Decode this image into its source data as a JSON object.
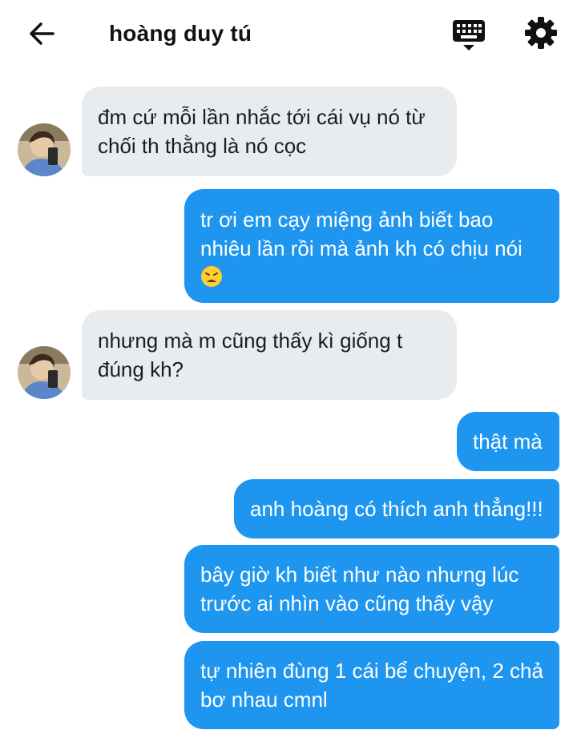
{
  "header": {
    "back_icon": "arrow-left-icon",
    "contact_name": "hoàng duy tú",
    "keyboard_icon": "keyboard-icon",
    "settings_icon": "gear-icon"
  },
  "messages": [
    {
      "direction": "incoming",
      "lines": [
        "đm cứ mỗi lần nhắc tới cái vụ nó từ",
        "chối th thằng là nó cọc"
      ]
    },
    {
      "direction": "outgoing",
      "lines": [
        "tr ơi em cạy miệng ảnh biết bao",
        "nhiêu lần rồi mà ảnh kh có chịu nói"
      ],
      "emoji": "weary-face-emoji"
    },
    {
      "direction": "incoming",
      "lines": [
        "nhưng mà m cũng thấy kì giống t",
        "đúng kh?"
      ]
    },
    {
      "direction": "outgoing",
      "lines": [
        "thật mà"
      ]
    },
    {
      "direction": "outgoing",
      "lines": [
        "anh hoàng có thích anh thẳng!!!"
      ]
    },
    {
      "direction": "outgoing",
      "lines": [
        "bây giờ kh biết như nào nhưng lúc",
        "trước ai nhìn vào cũng thấy vậy"
      ]
    },
    {
      "direction": "outgoing",
      "lines": [
        "tự nhiên đùng 1 cái bể chuyện, 2 chả",
        "bơ nhau cmnl"
      ]
    }
  ],
  "colors": {
    "outgoing_bubble": "#1e96f0",
    "incoming_bubble": "#e9ecef",
    "outgoing_text": "#ffffff",
    "incoming_text": "#1c1c1c"
  }
}
